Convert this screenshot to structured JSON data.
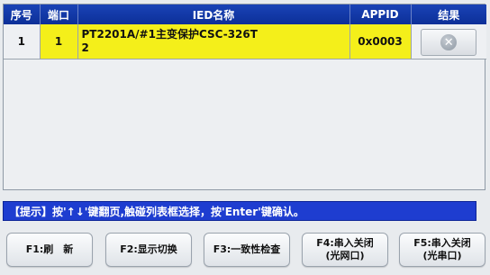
{
  "table": {
    "headers": {
      "seq": "序号",
      "port": "端口",
      "ied_name": "IED名称",
      "appid": "APPID",
      "result": "结果"
    },
    "rows": [
      {
        "seq": "1",
        "port": "1",
        "ied_name_line1": "PT2201A/#1主变保护CSC-326T",
        "ied_name_line2": "2",
        "appid": "0x0003",
        "result_icon": "close-circle-icon"
      }
    ]
  },
  "hint": {
    "text": "【提示】按'↑↓'键翻页,触碰列表框选择，按'Enter'键确认。"
  },
  "function_keys": [
    {
      "line1": "F1:刷　新",
      "line2": ""
    },
    {
      "line1": "F2:显示切换",
      "line2": ""
    },
    {
      "line1": "F3:一致性检查",
      "line2": ""
    },
    {
      "line1": "F4:串入关闭",
      "line2": "(光网口)"
    },
    {
      "line1": "F5:串入关闭",
      "line2": "(光串口)"
    }
  ],
  "colors": {
    "header_blue": "#1a43b6",
    "highlight_yellow": "#f4ef1a",
    "hint_blue": "#1e3dd0"
  }
}
